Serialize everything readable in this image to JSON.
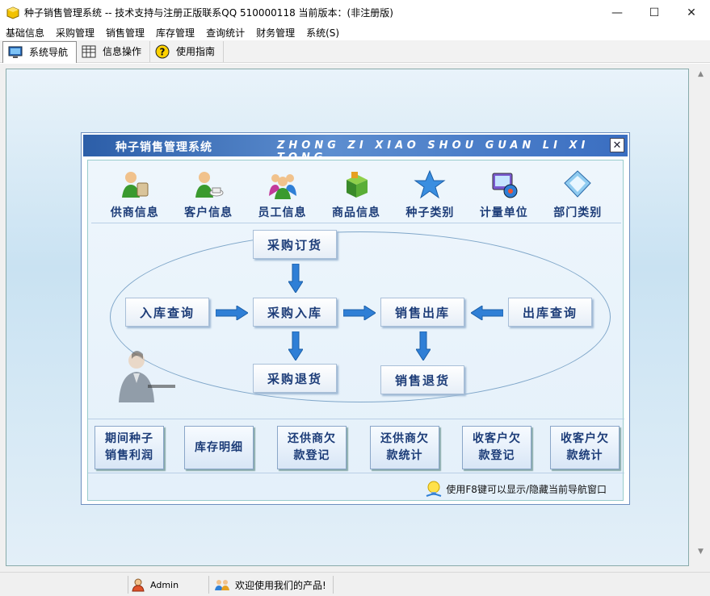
{
  "window": {
    "title": "种子销售管理系统 -- 技术支持与注册正版联系QQ 510000118    当前版本：(非注册版)",
    "minimize": "—",
    "maximize": "☐",
    "close": "✕"
  },
  "menu": [
    "基础信息",
    "采购管理",
    "销售管理",
    "库存管理",
    "查询统计",
    "财务管理",
    "系统(S)"
  ],
  "toolbar": {
    "tabs": [
      {
        "label": "系统导航",
        "icon": "monitor-icon"
      },
      {
        "label": "信息操作",
        "icon": "grid-icon"
      },
      {
        "label": "使用指南",
        "icon": "help-icon"
      }
    ]
  },
  "nav": {
    "title_cn": "种子销售管理系统",
    "title_en": "ZHONG ZI XIAO SHOU GUAN LI XI TONG",
    "close": "✕",
    "icons": [
      {
        "label": "供商信息",
        "icon": "supplier-icon"
      },
      {
        "label": "客户信息",
        "icon": "customer-icon"
      },
      {
        "label": "员工信息",
        "icon": "staff-icon"
      },
      {
        "label": "商品信息",
        "icon": "product-icon"
      },
      {
        "label": "种子类别",
        "icon": "star-icon"
      },
      {
        "label": "计量单位",
        "icon": "unit-icon"
      },
      {
        "label": "部门类别",
        "icon": "department-icon"
      }
    ],
    "flow": {
      "purchase_order": "采购订货",
      "stock_in_query": "入库查询",
      "purchase_in": "采购入库",
      "sales_out": "销售出库",
      "stock_out_query": "出库查询",
      "purchase_return": "采购退货",
      "sales_return": "销售退货"
    },
    "bottom": [
      {
        "line1": "期间种子",
        "line2": "销售利润"
      },
      {
        "line1": "库存明细",
        "line2": ""
      },
      {
        "line1": "还供商欠",
        "line2": "款登记"
      },
      {
        "line1": "还供商欠",
        "line2": "款统计"
      },
      {
        "line1": "收客户欠",
        "line2": "款登记"
      },
      {
        "line1": "收客户欠",
        "line2": "款统计"
      }
    ],
    "tip": "使用F8键可以显示/隐藏当前导航窗口"
  },
  "status": {
    "user": "Admin",
    "message": "欢迎使用我们的产品!"
  },
  "colors": {
    "title_gradient": "#2c5ea8",
    "label_text": "#1c3c78",
    "arrow": "#2f7fd6"
  }
}
